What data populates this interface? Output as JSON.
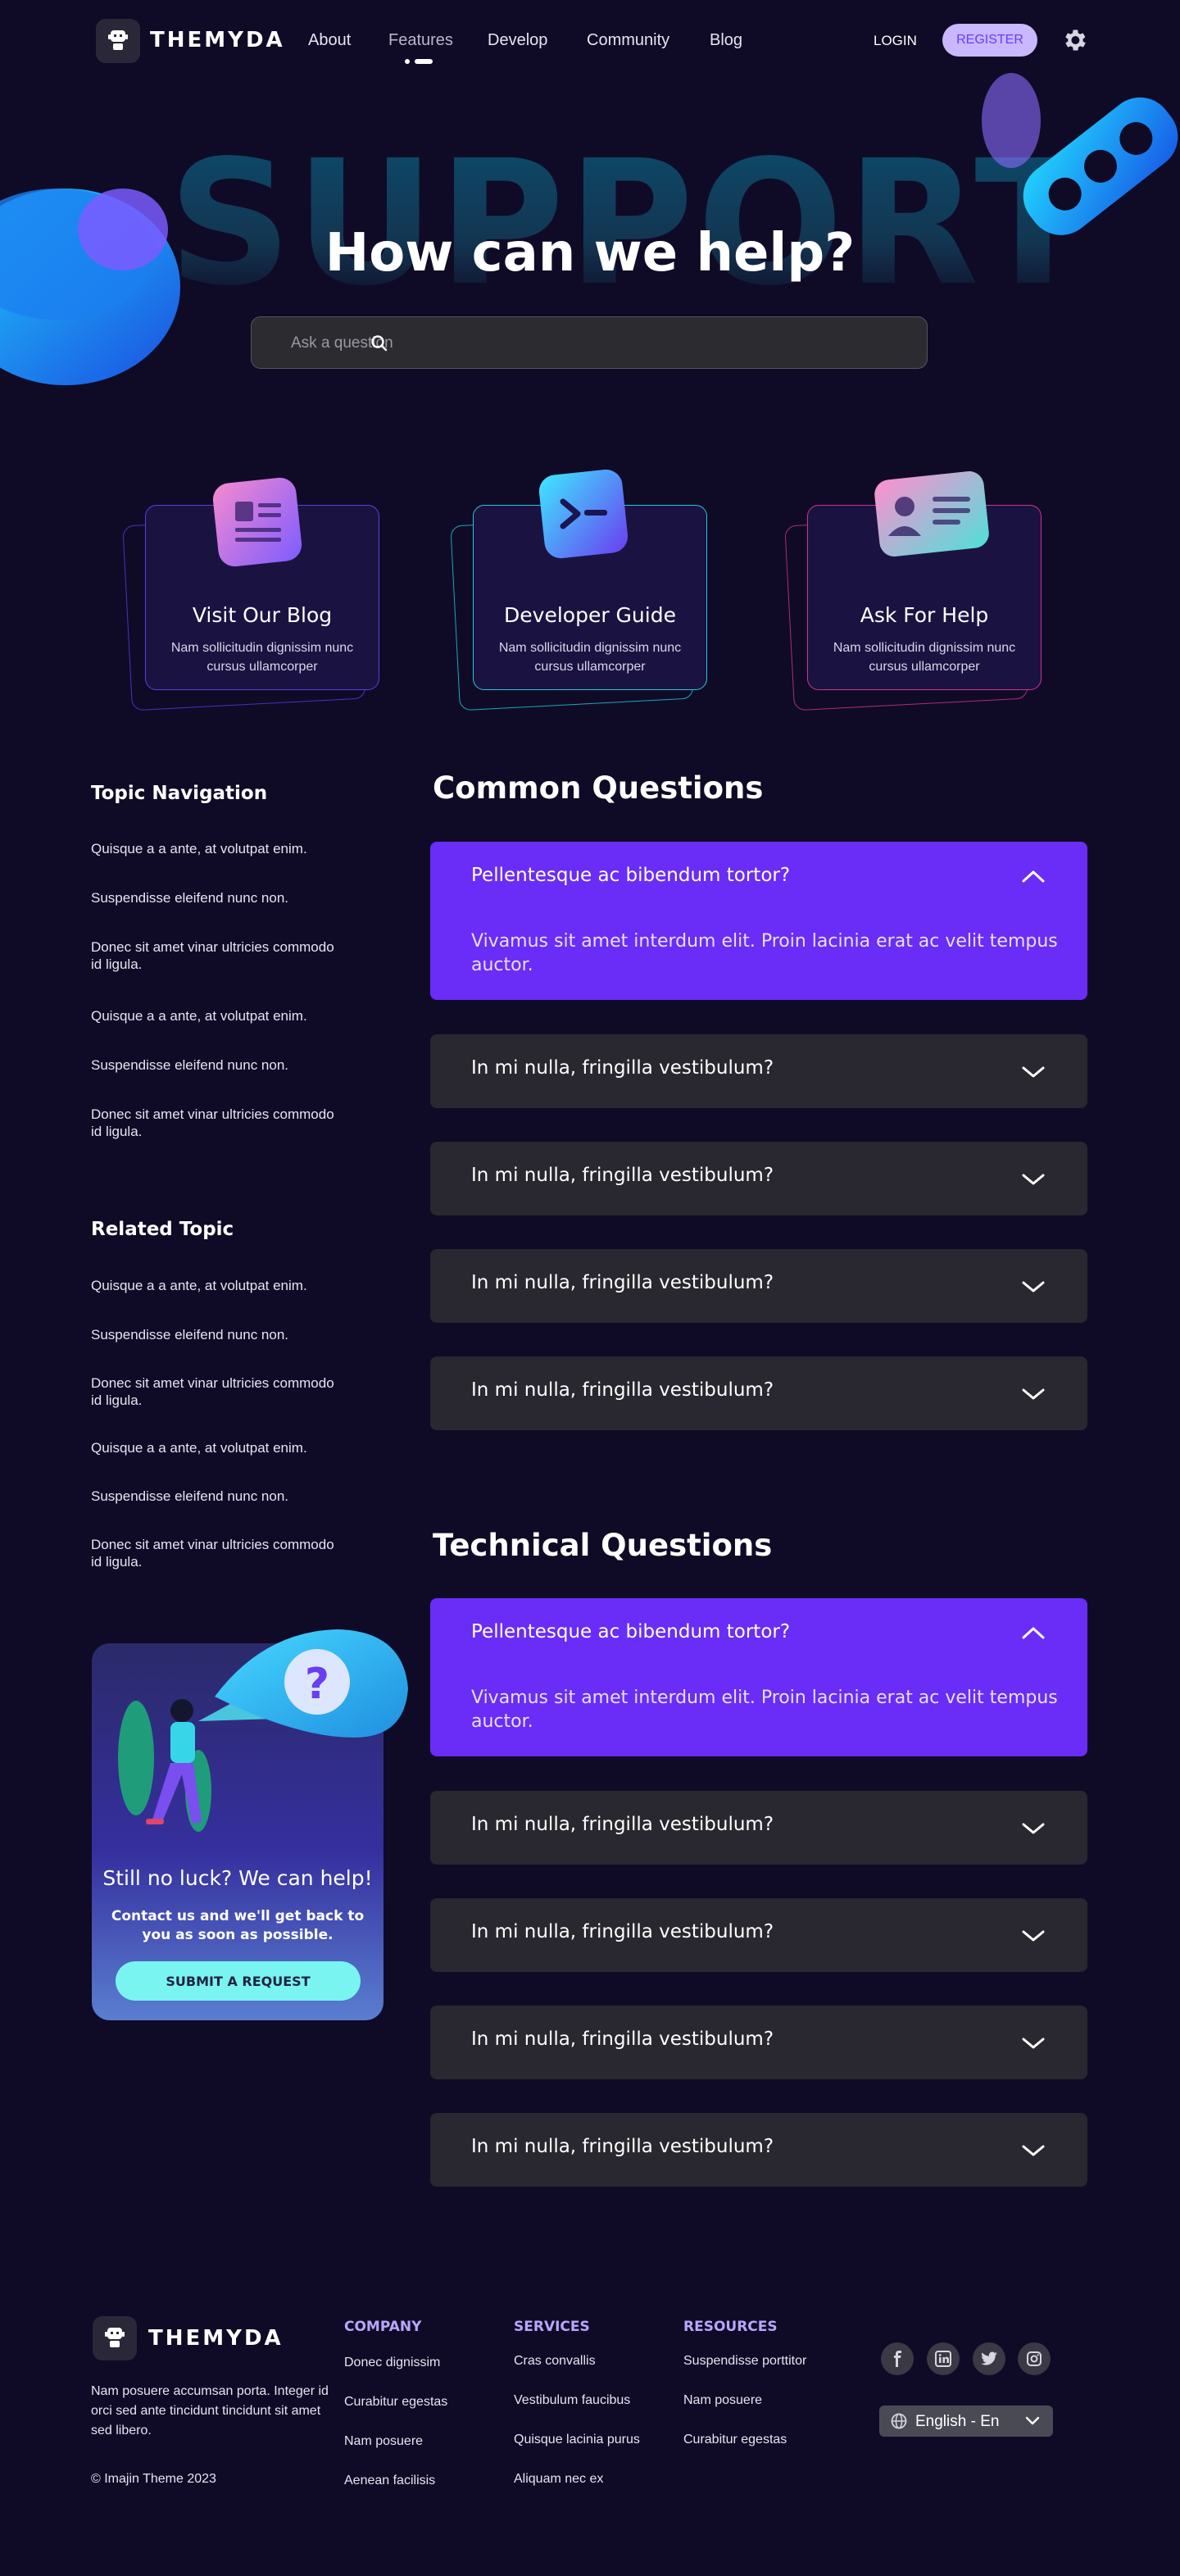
{
  "colors": {
    "background": "#0f0b26",
    "accent": "#6a2cf7",
    "register_bg": "#c9b7ff",
    "cta": "#79f4f1"
  },
  "nav": {
    "brand": "THEMYDA",
    "links": [
      "About",
      "Features",
      "Develop",
      "Community",
      "Blog"
    ],
    "active": "Features",
    "login": "LOGIN",
    "register": "REGISTER"
  },
  "hero": {
    "bg_word": "SUPPORT",
    "title": "How can we help?",
    "search_placeholder": "Ask a question"
  },
  "cards": [
    {
      "title": "Visit Our Blog",
      "desc": "Nam sollicitudin dignissim nunc cursus ullamcorper",
      "icon": "blog-icon"
    },
    {
      "title": "Developer Guide",
      "desc": "Nam sollicitudin dignissim nunc cursus ullamcorper",
      "icon": "terminal-icon"
    },
    {
      "title": "Ask For Help",
      "desc": "Nam sollicitudin dignissim nunc cursus ullamcorper",
      "icon": "id-card-icon"
    }
  ],
  "sidebar": {
    "topic_title": "Topic Navigation",
    "topic_links": [
      "Quisque a a ante, at volutpat enim.",
      "Suspendisse eleifend nunc non.",
      "Donec sit amet vinar ultricies commodo id ligula.",
      "Quisque a a ante, at volutpat enim.",
      "Suspendisse eleifend nunc non.",
      "Donec sit amet vinar ultricies commodo id ligula."
    ],
    "related_title": "Related Topic",
    "related_links": [
      "Quisque a a ante, at volutpat enim.",
      "Suspendisse eleifend nunc non.",
      "Donec sit amet vinar ultricies commodo id ligula.",
      "Quisque a a ante, at volutpat enim.",
      "Suspendisse eleifend nunc non.",
      "Donec sit amet vinar ultricies commodo id ligula."
    ]
  },
  "promo": {
    "title": "Still no luck? We can help!",
    "text": "Contact us and we'll get back to you as soon as possible.",
    "button": "SUBMIT A REQUEST"
  },
  "common": {
    "title": "Common Questions",
    "open_q": "Pellentesque ac bibendum tortor?",
    "open_a": "Vivamus sit amet interdum elit. Proin lacinia erat ac velit tempus auctor.",
    "items": [
      "In mi nulla, fringilla vestibulum?",
      "In mi nulla, fringilla vestibulum?",
      "In mi nulla, fringilla vestibulum?",
      "In mi nulla, fringilla vestibulum?"
    ]
  },
  "technical": {
    "title": "Technical Questions",
    "open_q": "Pellentesque ac bibendum tortor?",
    "open_a": "Vivamus sit amet interdum elit. Proin lacinia erat ac velit tempus auctor.",
    "items": [
      "In mi nulla, fringilla vestibulum?",
      "In mi nulla, fringilla vestibulum?",
      "In mi nulla, fringilla vestibulum?",
      "In mi nulla, fringilla vestibulum?"
    ]
  },
  "footer": {
    "brand": "THEMYDA",
    "desc": "Nam posuere accumsan porta. Integer id orci sed ante tincidunt tincidunt sit amet sed libero.",
    "copyright": "© Imajin Theme 2023",
    "company": {
      "title": "COMPANY",
      "links": [
        "Donec dignissim",
        "Curabitur egestas",
        "Nam posuere",
        "Aenean facilisis"
      ]
    },
    "services": {
      "title": "SERVICES",
      "links": [
        "Cras convallis",
        "Vestibulum faucibus",
        "Quisque lacinia purus",
        "Aliquam nec ex"
      ]
    },
    "resources": {
      "title": "RESOURCES",
      "links": [
        "Suspendisse porttitor",
        "Nam posuere",
        "Curabitur egestas"
      ]
    },
    "social": [
      "facebook-icon",
      "linkedin-icon",
      "twitter-icon",
      "instagram-icon"
    ],
    "language": "English - En"
  }
}
